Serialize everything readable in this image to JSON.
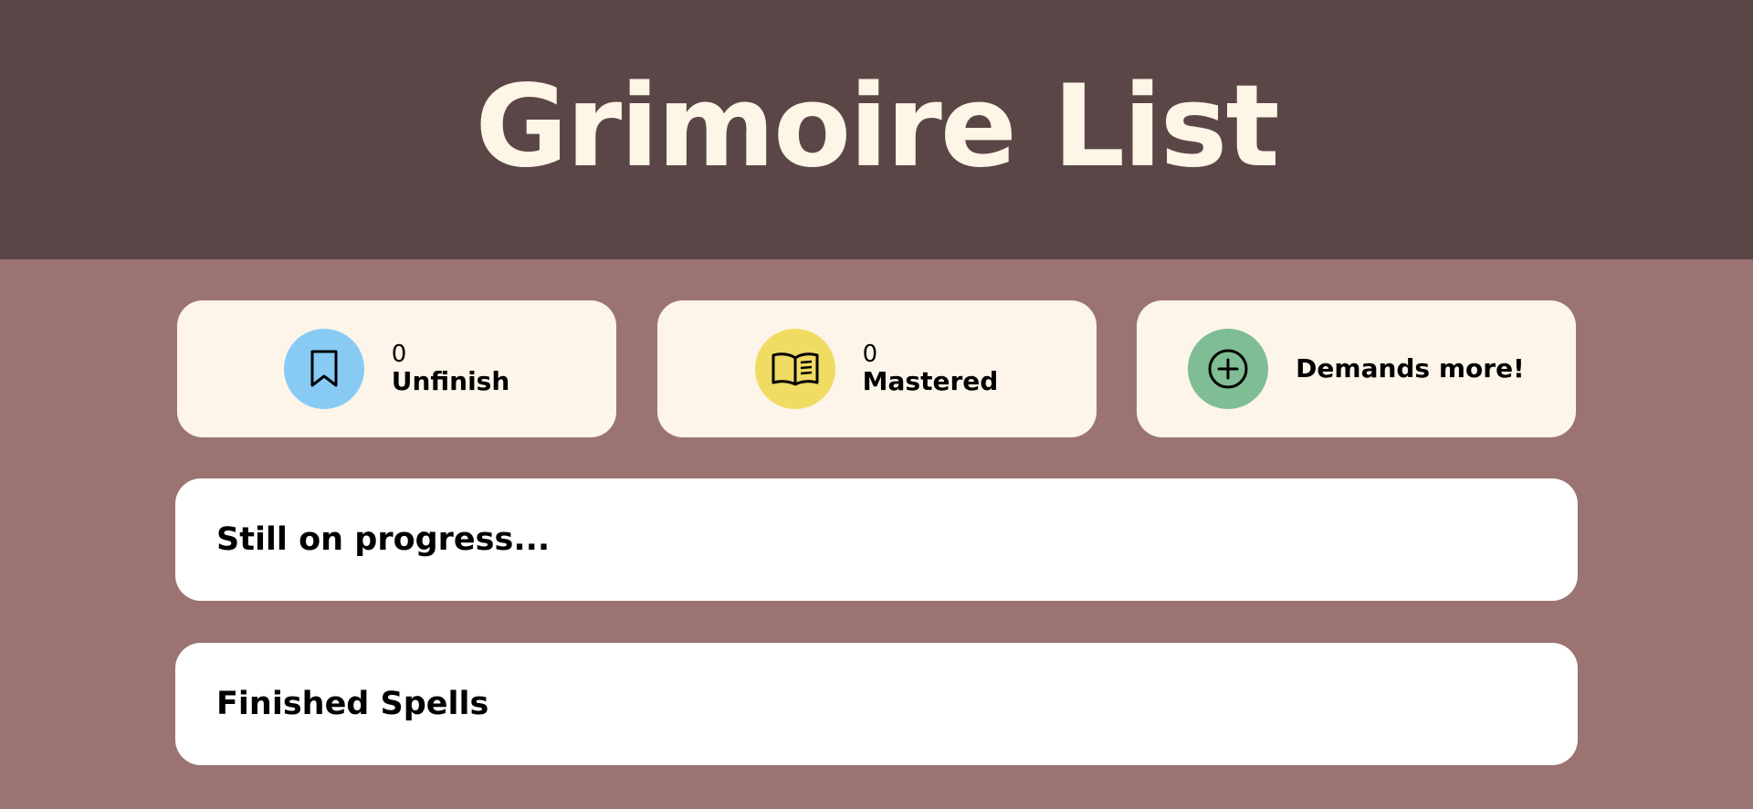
{
  "header": {
    "title": "Grimoire List"
  },
  "stats": [
    {
      "count": "0",
      "label": "Unfinish",
      "icon": "bookmark-icon",
      "color": "#87cbf5"
    },
    {
      "count": "0",
      "label": "Mastered",
      "icon": "open-book-icon",
      "color": "#f0db63"
    },
    {
      "label": "Demands more!",
      "icon": "plus-circle-icon",
      "color": "#7fbd94"
    }
  ],
  "sections": {
    "in_progress_title": "Still on progress...",
    "finished_title": "Finished Spells"
  },
  "colors": {
    "header_bg": "#5b4647",
    "page_bg": "#9b7472",
    "card_bg": "#fdf5e9",
    "title_color": "#fdf5e6"
  }
}
